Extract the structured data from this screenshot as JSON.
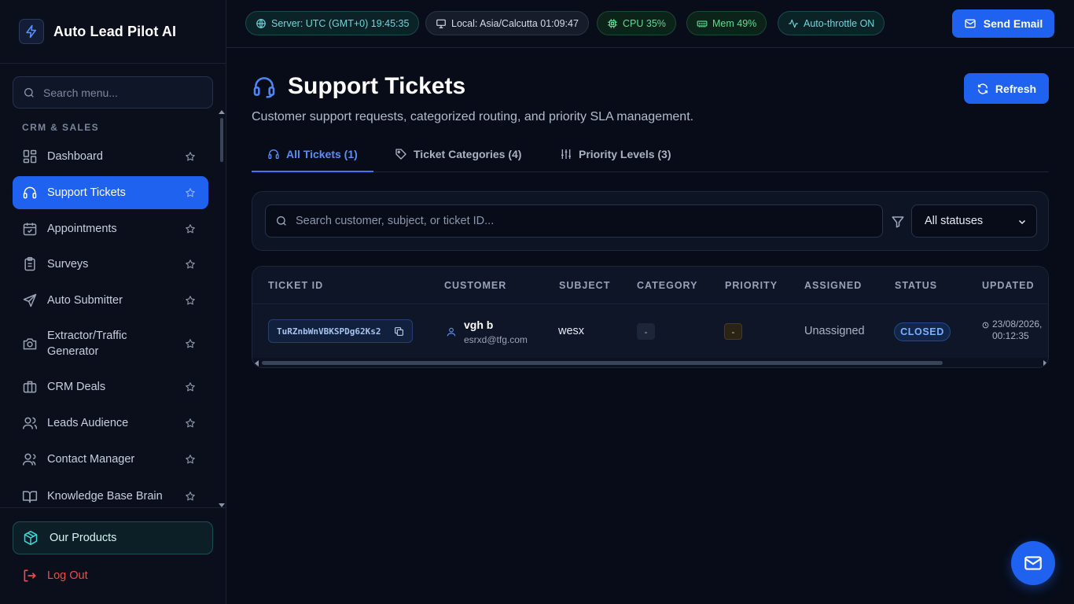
{
  "brand": {
    "name": "Auto Lead Pilot AI",
    "logo_icon": "bolt-icon"
  },
  "sidebar": {
    "search_placeholder": "Search menu...",
    "section_label": "CRM & SALES",
    "items": [
      {
        "label": "Dashboard",
        "icon": "dashboard-icon",
        "active": false
      },
      {
        "label": "Support Tickets",
        "icon": "headset-icon",
        "active": true
      },
      {
        "label": "Appointments",
        "icon": "calendar-icon",
        "active": false
      },
      {
        "label": "Surveys",
        "icon": "clipboard-icon",
        "active": false
      },
      {
        "label": "Auto Submitter",
        "icon": "send-icon",
        "active": false
      },
      {
        "label": "Extractor/Traffic Generator",
        "icon": "camera-icon",
        "active": false
      },
      {
        "label": "CRM Deals",
        "icon": "briefcase-icon",
        "active": false
      },
      {
        "label": "Leads Audience",
        "icon": "users-icon",
        "active": false
      },
      {
        "label": "Contact Manager",
        "icon": "user-group-icon",
        "active": false
      },
      {
        "label": "Knowledge Base Brain",
        "icon": "book-icon",
        "active": false
      }
    ],
    "products_label": "Our Products",
    "logout_label": "Log Out"
  },
  "topbar": {
    "chips": [
      {
        "label": "Server: UTC (GMT+0) 19:45:35",
        "icon": "globe-icon",
        "tone": "teal"
      },
      {
        "label": "Local: Asia/Calcutta 01:09:47",
        "icon": "monitor-icon",
        "tone": "gray"
      },
      {
        "label": "CPU 35%",
        "icon": "cpu-icon",
        "tone": "green"
      },
      {
        "label": "Mem 49%",
        "icon": "memory-icon",
        "tone": "green"
      },
      {
        "label": "Auto-throttle ON",
        "icon": "activity-icon",
        "tone": "teal"
      }
    ],
    "send_email_label": "Send Email"
  },
  "page": {
    "title": "Support Tickets",
    "subtitle": "Customer support requests, categorized routing, and priority SLA management.",
    "refresh_label": "Refresh"
  },
  "tabs": [
    {
      "label": "All Tickets (1)",
      "icon": "headset-icon",
      "active": true
    },
    {
      "label": "Ticket Categories (4)",
      "icon": "tag-icon",
      "active": false
    },
    {
      "label": "Priority Levels (3)",
      "icon": "sliders-icon",
      "active": false
    }
  ],
  "filters": {
    "search_placeholder": "Search customer, subject, or ticket ID...",
    "status_selected": "All statuses"
  },
  "table": {
    "columns": [
      "TICKET ID",
      "CUSTOMER",
      "SUBJECT",
      "CATEGORY",
      "PRIORITY",
      "ASSIGNED",
      "STATUS",
      "UPDATED"
    ],
    "rows": [
      {
        "ticket_id": "TuRZnbWnVBKSPDg62Ks2",
        "customer_name": "vgh b",
        "customer_email": "esrxd@tfg.com",
        "subject": "wesx",
        "category": "-",
        "priority": "-",
        "assigned": "Unassigned",
        "status": "CLOSED",
        "updated_date": "23/08/2026,",
        "updated_time": "00:12:35"
      }
    ]
  },
  "colors": {
    "accent": "#1f62f0",
    "background": "#070c18",
    "sidebar": "#0a0f1b",
    "status_closed": "#7fb0ff",
    "logout": "#ef4b4b"
  }
}
